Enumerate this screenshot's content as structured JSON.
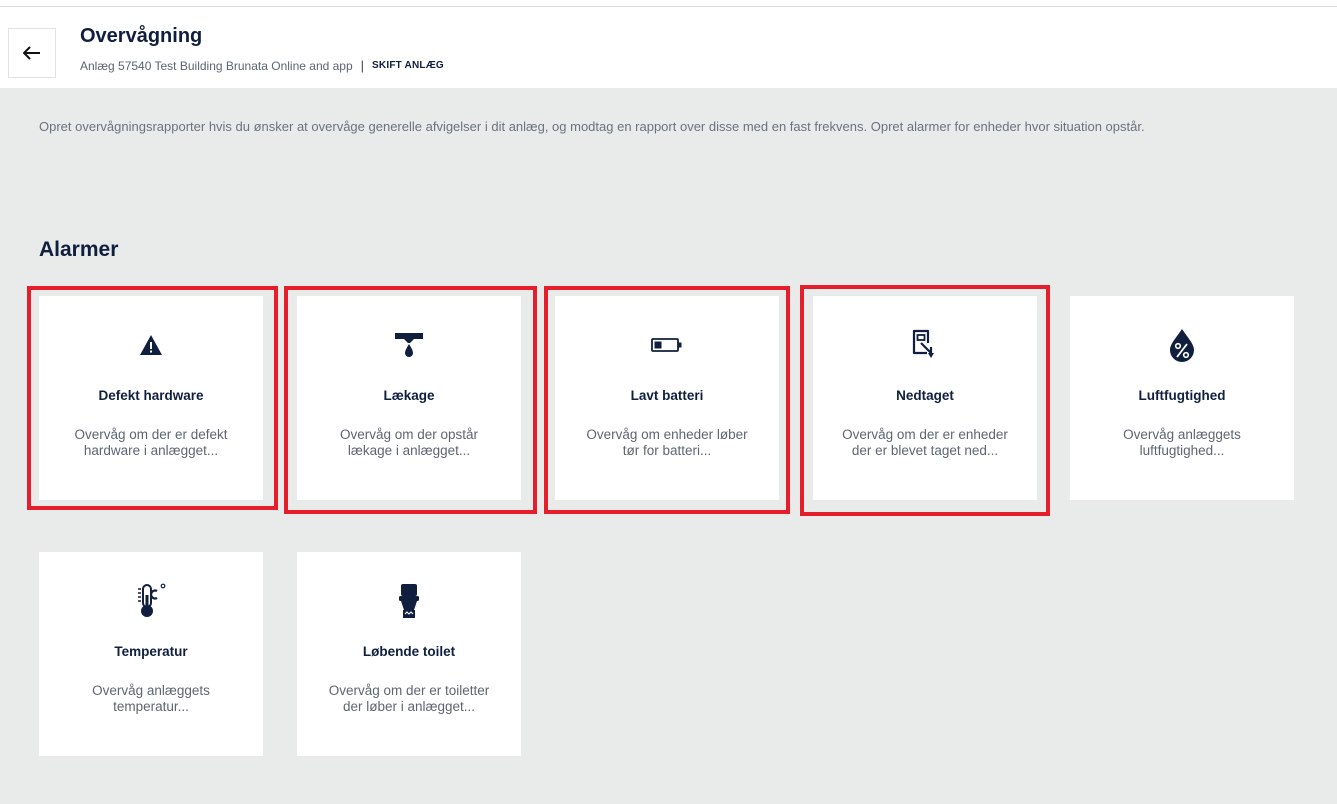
{
  "header": {
    "title": "Overvågning",
    "plant_label": "Anlæg 57540 Test Building Brunata Online and app",
    "separator": "|",
    "switch_label": "SKIFT ANLÆG"
  },
  "intro_text": "Opret overvågningsrapporter hvis du ønsker at overvåge generelle afvigelser i dit anlæg, og modtag en rapport over disse med en fast frekvens. Opret alarmer for enheder hvor situation opstår.",
  "section_title": "Alarmer",
  "cards": [
    {
      "icon": "warning-icon",
      "name": "Defekt hardware",
      "desc": "Overvåg om der er defekt hardware i anlægget...",
      "highlighted": true
    },
    {
      "icon": "leak-icon",
      "name": "Lækage",
      "desc": "Overvåg om der opstår lækage i anlægget...",
      "highlighted": true
    },
    {
      "icon": "battery-low-icon",
      "name": "Lavt batteri",
      "desc": "Overvåg om enheder løber tør for batteri...",
      "highlighted": true
    },
    {
      "icon": "device-removed-icon",
      "name": "Nedtaget",
      "desc": "Overvåg om der er enheder der er blevet taget ned...",
      "highlighted": true
    },
    {
      "icon": "humidity-icon",
      "name": "Luftfugtighed",
      "desc": "Overvåg anlæggets luftfugtighed...",
      "highlighted": false
    },
    {
      "icon": "thermometer-icon",
      "name": "Temperatur",
      "desc": "Overvåg anlæggets temperatur...",
      "highlighted": false
    },
    {
      "icon": "toilet-icon",
      "name": "Løbende toilet",
      "desc": "Overvåg om der er toiletter der løber i anlægget...",
      "highlighted": false
    }
  ],
  "colors": {
    "highlight": "#e41e2a",
    "navy": "#0f1f3d",
    "background": "#e9ebea"
  }
}
